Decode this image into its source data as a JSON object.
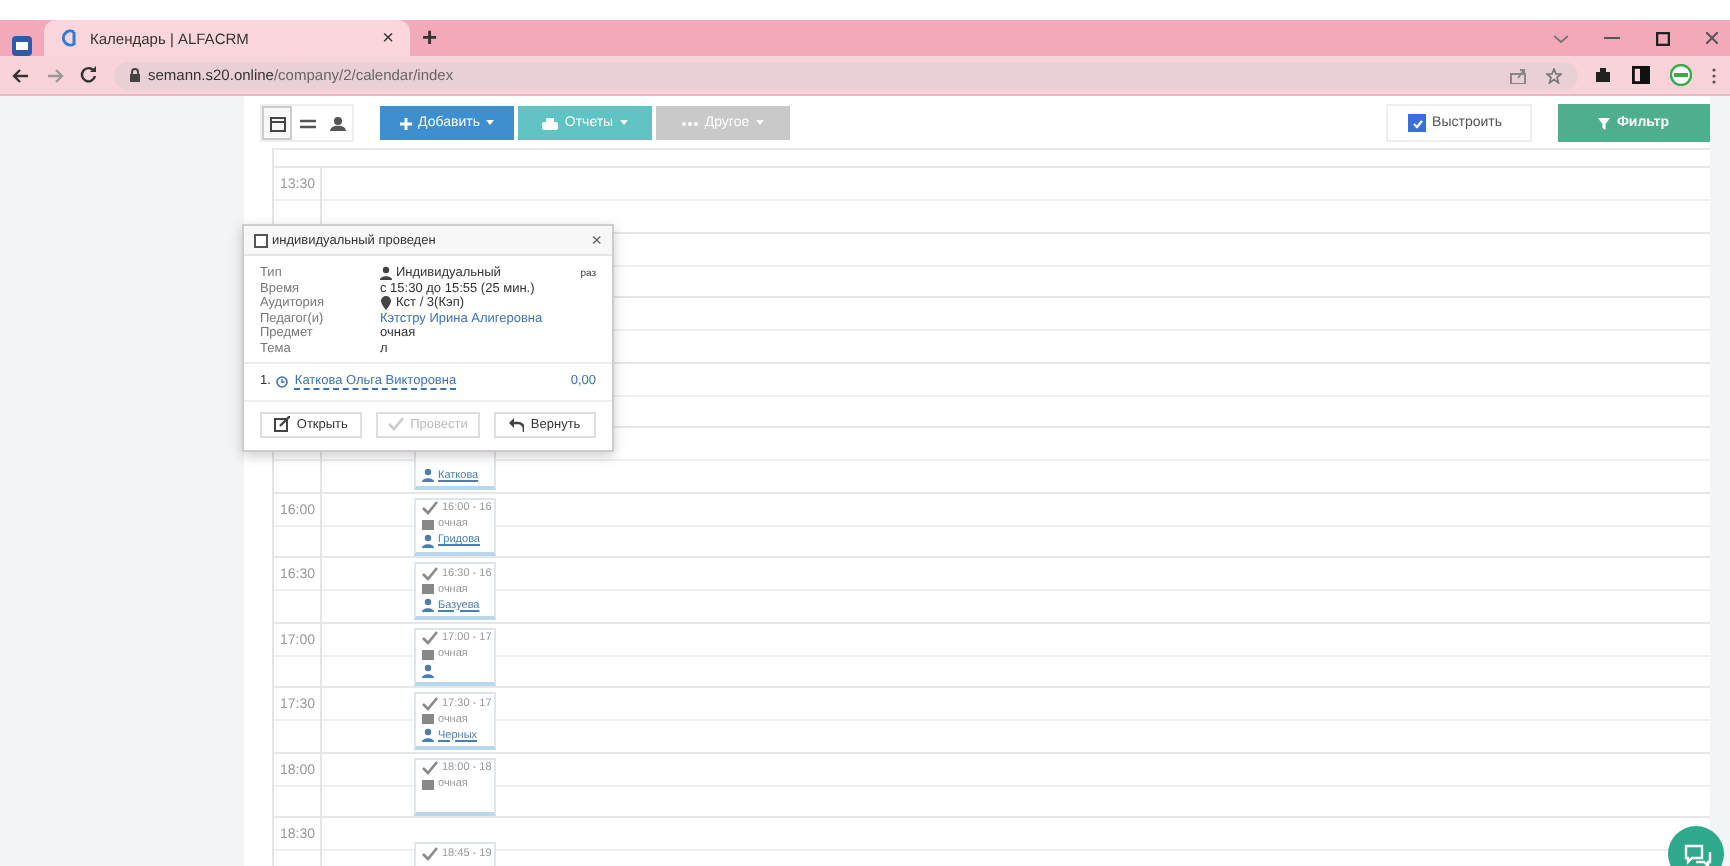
{
  "browser": {
    "tab_title": "Календарь | ALFACRM",
    "tab_close": "×",
    "new_tab": "+",
    "url_host": "semann.s20.online",
    "url_path": "/company/2/calendar/index"
  },
  "toolbar": {
    "views": [
      {
        "kind": "calendar",
        "selected": true
      },
      {
        "kind": "list",
        "selected": false
      },
      {
        "kind": "group",
        "selected": false
      }
    ],
    "buttons": [
      {
        "label": "Добавить",
        "kind": "primary",
        "disabled": false
      },
      {
        "label": "Отчеты",
        "kind": "info",
        "disabled": false
      },
      {
        "label": "Другое",
        "kind": "default",
        "disabled": true
      }
    ],
    "arrange": {
      "label": "Выстроить",
      "checked": true
    },
    "filter": "Фильтр"
  },
  "calendar": {
    "slots": [
      {
        "time": "13:30"
      },
      {
        "events": [
          {
            "lines": [
              {
                "kind": "student",
                "text": "Каткова"
              }
            ]
          }
        ]
      },
      {
        "time": "16:00",
        "events": [
          {
            "lines": [
              {
                "kind": "time",
                "text": "16:00 - 16"
              },
              {
                "kind": "subject",
                "text": "очная"
              },
              {
                "kind": "student",
                "text": "Гридова"
              }
            ]
          }
        ]
      },
      {
        "time": "16:30",
        "events": [
          {
            "lines": [
              {
                "kind": "time",
                "text": "16:30 - 16"
              },
              {
                "kind": "subject",
                "text": "очная"
              },
              {
                "kind": "student",
                "text": "Базуева"
              }
            ]
          }
        ]
      },
      {
        "time": "17:00",
        "events": [
          {
            "lines": [
              {
                "kind": "time",
                "text": "17:00 - 17"
              },
              {
                "kind": "subject",
                "text": "очная"
              },
              {
                "kind": "student"
              }
            ]
          }
        ]
      },
      {
        "time": "17:30",
        "events": [
          {
            "lines": [
              {
                "kind": "time",
                "text": "17:30 - 17"
              },
              {
                "kind": "subject",
                "text": "очная"
              },
              {
                "kind": "student",
                "text": "Черных"
              }
            ]
          }
        ]
      },
      {
        "time": "18:00",
        "events": [
          {
            "lines": [
              {
                "kind": "time",
                "text": "18:00 - 18"
              },
              {
                "kind": "subject",
                "text": "очная"
              }
            ]
          }
        ]
      },
      {
        "time": "18:30",
        "events": [
          {
            "lines": [
              {
                "kind": "time",
                "text": "18:45 - 19"
              }
            ]
          }
        ]
      }
    ]
  },
  "popup": {
    "title": "индивидуальный проведен",
    "checked": false,
    "close": "×",
    "fields": [
      {
        "label": "Тип",
        "value": "Индивидуальный",
        "kind": "text",
        "note": "раз"
      },
      {
        "label": "Время",
        "value": "с 15:30 до 15:55 (25 мин.)",
        "kind": "text"
      },
      {
        "label": "Аудитория",
        "value": "Кст / 3(Кэп)",
        "kind": "text"
      },
      {
        "label": "Педагог(и)",
        "value": "Кэтстру Ирина Алигеровна",
        "kind": "link"
      },
      {
        "label": "Предмет",
        "value": "очная",
        "kind": "text"
      },
      {
        "label": "Тема",
        "value": "л",
        "kind": "text"
      }
    ],
    "students": [
      {
        "number": "1.",
        "name": "Каткова Ольга Викторовна",
        "amount": "0,00"
      }
    ],
    "buttons": [
      {
        "label": "Открыть",
        "disabled": false
      },
      {
        "label": "Провести",
        "disabled": true
      },
      {
        "label": "Вернуть",
        "disabled": false
      }
    ]
  }
}
